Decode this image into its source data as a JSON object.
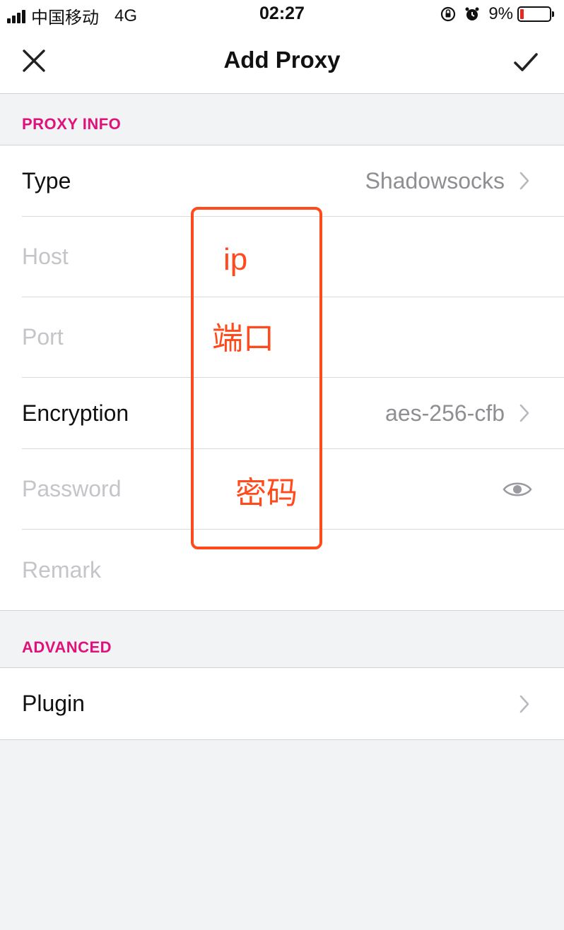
{
  "status_bar": {
    "carrier": "中国移动",
    "network": "4G",
    "time": "02:27",
    "battery_percent": "9%",
    "icons": [
      "signal-icon",
      "rotation-lock-icon",
      "alarm-icon",
      "battery-icon"
    ]
  },
  "nav": {
    "title": "Add Proxy",
    "close_icon": "close-icon",
    "done_icon": "checkmark-icon"
  },
  "proxy_info": {
    "header": "PROXY INFO",
    "type_label": "Type",
    "type_value": "Shadowsocks",
    "host_placeholder": "Host",
    "port_placeholder": "Port",
    "encryption_label": "Encryption",
    "encryption_value": "aes-256-cfb",
    "password_placeholder": "Password",
    "remark_placeholder": "Remark"
  },
  "advanced": {
    "header": "ADVANCED",
    "plugin_label": "Plugin"
  },
  "annotations": {
    "ip": "ip",
    "port": "端口",
    "password": "密码",
    "color": "#ff4a1c"
  },
  "colors": {
    "accent": "#e0117a",
    "background": "#f2f3f5",
    "placeholder": "#c4c4c9",
    "secondary_text": "#8e8e93"
  }
}
